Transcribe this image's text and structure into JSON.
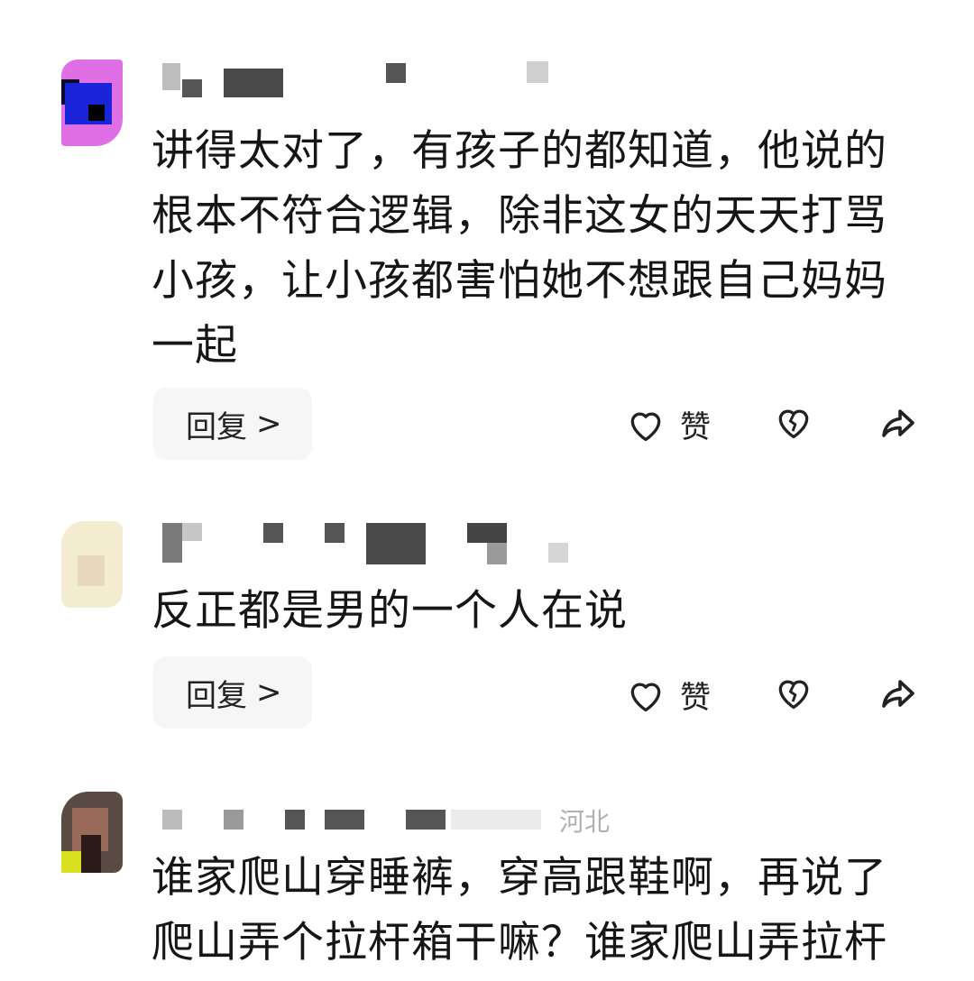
{
  "comments": [
    {
      "text": "讲得太对了，有孩子的都知道，他说的根本不符合逻辑，除非这女的天天打骂小孩，让小孩都害怕她不想跟自己妈妈一起",
      "reply_label": "回复",
      "reply_chevron": ">",
      "like_label": "赞"
    },
    {
      "text": "反正都是男的一个人在说",
      "reply_label": "回复",
      "reply_chevron": ">",
      "like_label": "赞"
    },
    {
      "meta_visible": "河北",
      "text": "谁家爬山穿睡裤，穿高跟鞋啊，再说了爬山弄个拉杆箱干嘛？谁家爬山弄拉杆"
    }
  ],
  "icons": {
    "like": "heart-outline-icon",
    "dislike": "broken-heart-icon",
    "share": "share-arrow-icon"
  }
}
